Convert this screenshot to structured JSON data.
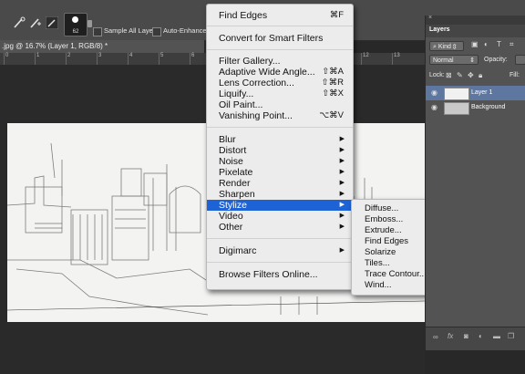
{
  "options_bar": {
    "brush_size": "62",
    "sample_all_layers_label": "Sample All Layers",
    "auto_enhance_label": "Auto-Enhance"
  },
  "document": {
    "tab_title": ".jpg @ 16.7% (Layer 1, RGB/8) *",
    "ruler_ticks": [
      "0",
      "1",
      "2",
      "3",
      "4",
      "5",
      "6",
      "12",
      "13"
    ]
  },
  "filter_menu": {
    "top": [
      {
        "label": "Find Edges",
        "shortcut": "⌘F"
      },
      {
        "label": "Convert for Smart Filters",
        "shortcut": ""
      }
    ],
    "group2": [
      {
        "label": "Filter Gallery...",
        "shortcut": ""
      },
      {
        "label": "Adaptive Wide Angle...",
        "shortcut": "⇧⌘A"
      },
      {
        "label": "Lens Correction...",
        "shortcut": "⇧⌘R"
      },
      {
        "label": "Liquify...",
        "shortcut": "⇧⌘X"
      },
      {
        "label": "Oil Paint...",
        "shortcut": ""
      },
      {
        "label": "Vanishing Point...",
        "shortcut": "⌥⌘V"
      }
    ],
    "group3": [
      "Blur",
      "Distort",
      "Noise",
      "Pixelate",
      "Render",
      "Sharpen",
      "Stylize",
      "Video",
      "Other"
    ],
    "group4": [
      "Digimarc"
    ],
    "group5": [
      "Browse Filters Online..."
    ],
    "highlighted": "Stylize"
  },
  "stylize_submenu": [
    "Diffuse...",
    "Emboss...",
    "Extrude...",
    "Find Edges",
    "Solarize",
    "Tiles...",
    "Trace Contour...",
    "Wind..."
  ],
  "layers_panel": {
    "title": "Layers",
    "kind_label": "Kind",
    "blend_mode": "Normal",
    "opacity_label": "Opacity:",
    "lock_label": "Lock:",
    "fill_label": "Fill:",
    "layers": [
      {
        "name": "Layer 1",
        "selected": true
      },
      {
        "name": "Background",
        "selected": false
      }
    ],
    "footer_icons": [
      "link-icon",
      "fx-icon",
      "mask-icon",
      "adjustment-icon",
      "folder-icon",
      "new-layer-icon"
    ]
  },
  "colors": {
    "menu_highlight": "#1e63d6",
    "panel_bg": "#535353",
    "workspace_bg": "#282828"
  }
}
